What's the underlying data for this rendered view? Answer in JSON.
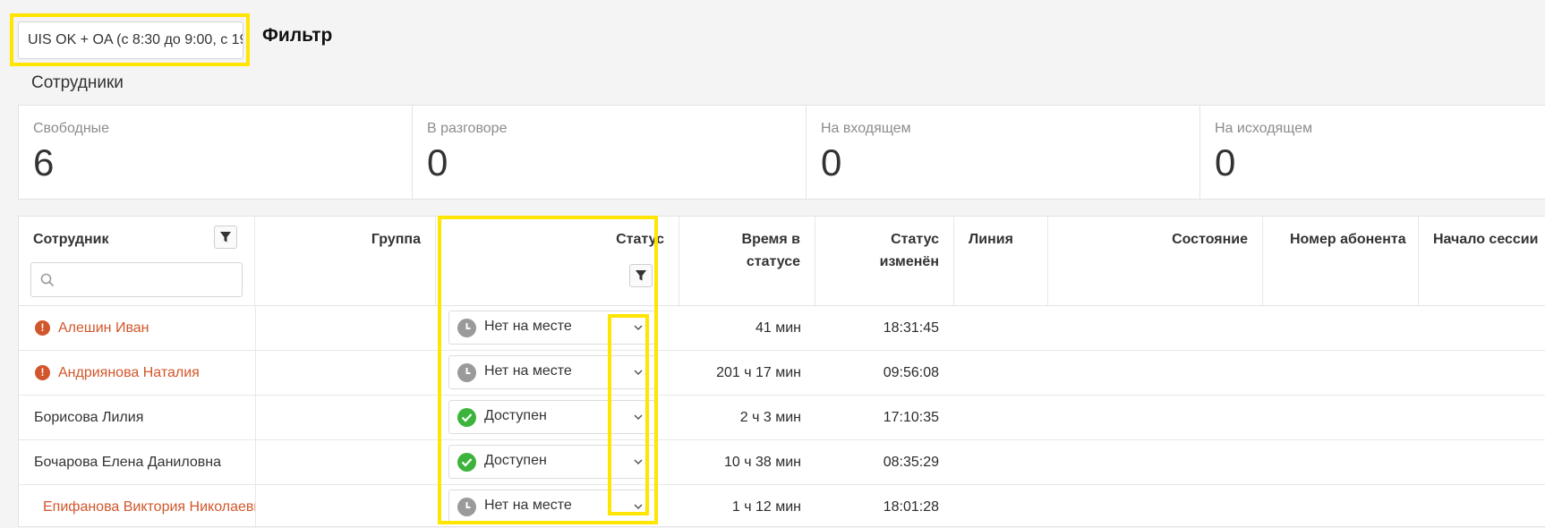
{
  "filter": {
    "selected": "UIS OK + OA (с 8:30 до 9:00, с 19",
    "title": "Фильтр"
  },
  "section_title": "Сотрудники",
  "stats": [
    {
      "label": "Свободные",
      "value": "6"
    },
    {
      "label": "В разговоре",
      "value": "0"
    },
    {
      "label": "На входящем",
      "value": "0"
    },
    {
      "label": "На исходящем",
      "value": "0"
    }
  ],
  "table": {
    "columns": {
      "employee": "Сотрудник",
      "group": "Группа",
      "status": "Статус",
      "time_in_status": "Время в статусе",
      "status_changed": "Статус изменён",
      "line": "Линия",
      "state": "Состояние",
      "subscriber": "Номер абонента",
      "session_start": "Начало сессии"
    },
    "rows": [
      {
        "name": "Алешин Иван",
        "alert": true,
        "status": "Нет на месте",
        "time": "41 мин",
        "changed": "18:31:45"
      },
      {
        "name": "Андриянова Наталия",
        "alert": true,
        "status": "Нет на месте",
        "time": "201 ч 17 мин",
        "changed": "09:56:08"
      },
      {
        "name": "Борисова Лилия",
        "alert": false,
        "status": "Доступен",
        "time": "2 ч 3 мин",
        "changed": "17:10:35"
      },
      {
        "name": "Бочарова Елена Даниловна",
        "alert": false,
        "status": "Доступен",
        "time": "10 ч 38 мин",
        "changed": "08:35:29"
      },
      {
        "name": "Епифанова Виктория Николаевна",
        "alert": false,
        "status": "Нет на месте",
        "time": "1 ч 12 мин",
        "changed": "18:01:28"
      }
    ]
  },
  "colors": {
    "highlight": "#ffe500",
    "alert": "#d2562b",
    "available": "#3cb43c",
    "away": "#9a9a9a"
  }
}
